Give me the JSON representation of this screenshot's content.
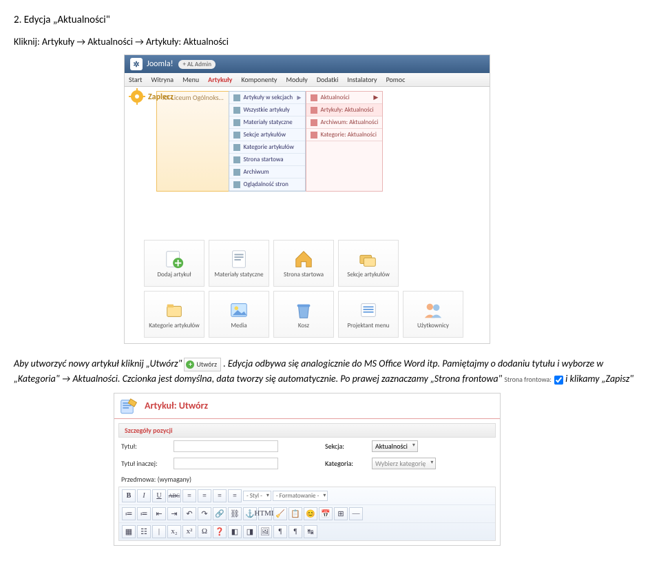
{
  "doc": {
    "heading": "2. Edycja „Aktualności\"",
    "breadcrumb_instruction": "Kliknij: Artykuły → Aktualności → Artykuły: Aktualności"
  },
  "joomla": {
    "brand": "Joomla!",
    "plus_admin": "+ AL Admin",
    "menu": [
      "Start",
      "Witryna",
      "Menu",
      "Artykuły",
      "Komponenty",
      "Moduły",
      "Dodatki",
      "Instalatory",
      "Pomoc"
    ],
    "menu_active_index": 3,
    "bc_left": "XX Liceum Ogólnoks…",
    "dropdown": [
      {
        "label": "Artykuły w sekcjach",
        "arrow": true
      },
      {
        "label": "Wszystkie artykuły"
      },
      {
        "label": "Materiały statyczne"
      },
      {
        "label": "Sekcje artykułów"
      },
      {
        "label": "Kategorie artykułów"
      },
      {
        "label": "Strona startowa"
      },
      {
        "label": "Archiwum"
      },
      {
        "label": "Oglądalność stron"
      }
    ],
    "side_dropdown": [
      {
        "label": "Aktualności",
        "arrow": true
      },
      {
        "label": "Artykuły: Aktualności",
        "active": true
      },
      {
        "label": "Archiwum: Aktualności"
      },
      {
        "label": "Kategorie: Aktualności"
      }
    ],
    "zaplecze": "Zaplecz",
    "icons_row1": [
      {
        "label": "Dodaj artykuł",
        "icon": "plus"
      },
      {
        "label": "Materiały statyczne",
        "icon": "doc"
      },
      {
        "label": "Strona startowa",
        "icon": "home"
      },
      {
        "label": "Sekcje artykułów",
        "icon": "folders"
      }
    ],
    "icons_row2": [
      {
        "label": "Kategorie artykułów",
        "icon": "folder"
      },
      {
        "label": "Media",
        "icon": "image"
      },
      {
        "label": "Kosz",
        "icon": "trash"
      },
      {
        "label": "Projektant menu",
        "icon": "menu"
      },
      {
        "label": "Użytkownicy",
        "icon": "users"
      }
    ]
  },
  "paragraph": {
    "p1a": "Aby utworzyć nowy artykuł kliknij „Utwórz\" ",
    "inline_btn": "Utwórz",
    "p1b": ". Edycja odbywa się analogicznie do MS Office Word itp. Pamiętajmy o dodaniu tytułu i wyborze w",
    "p2": "„Kategoria\" → Aktualności. Czcionka jest domyślna, data tworzy się automatycznie. Po prawej zaznaczamy „Strona frontowa\" ",
    "frontowa_label": "Strona frontowa:",
    "p3": " i klikamy „Zapisz\""
  },
  "editor": {
    "title": "Artykuł: Utwórz",
    "panel": "Szczegóły pozycji",
    "tytul": "Tytuł:",
    "tytul_inaczej": "Tytuł inaczej:",
    "sekcja": "Sekcja:",
    "sekcja_val": "Aktualności",
    "kategoria": "Kategoria:",
    "kategoria_val": "Wybierz kategorię",
    "przedmowa": "Przedmowa: (wymagany)",
    "styl": "- Styl -",
    "format": "- Formatowanie -",
    "buttons_row1": [
      "B",
      "I",
      "U",
      "ABC",
      "≡",
      "≡",
      "≡",
      "≡"
    ],
    "buttons_row2": [
      "≔",
      "≔",
      "⇤",
      "⇥",
      "↶",
      "↷",
      "🔗",
      "⛓",
      "⚓",
      "HTML",
      "🧹",
      "📋",
      "😊",
      "📅",
      "⊞",
      "—"
    ],
    "buttons_row3": [
      "▦",
      "☷",
      "|",
      "x₂",
      "x²",
      "Ω",
      "❓",
      "◧",
      "◨",
      "🖼",
      "¶",
      "¶",
      "↹"
    ]
  }
}
